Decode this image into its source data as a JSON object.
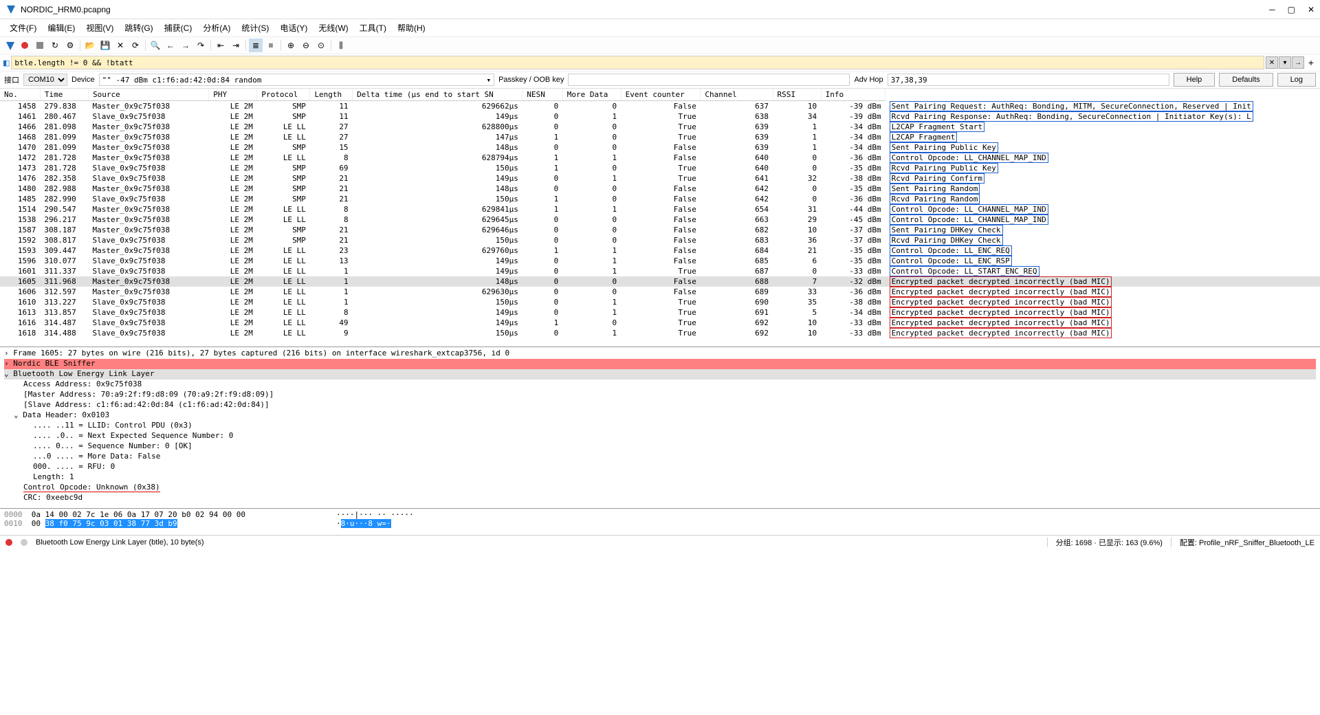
{
  "window": {
    "title": "NORDIC_HRM0.pcapng"
  },
  "menu": [
    "文件(F)",
    "编辑(E)",
    "视图(V)",
    "跳转(G)",
    "捕获(C)",
    "分析(A)",
    "统计(S)",
    "电话(Y)",
    "无线(W)",
    "工具(T)",
    "帮助(H)"
  ],
  "filter": {
    "value": "btle.length != 0 && !btatt"
  },
  "second": {
    "interface_label": "接口",
    "interface_value": "COM10",
    "device_label": "Device",
    "device_value": "\"\"  -47 dBm  c1:f6:ad:42:0d:84  random",
    "passkey_label": "Passkey / OOB key",
    "advhop_label": "Adv Hop",
    "advhop_value": "37,38,39",
    "buttons": {
      "help": "Help",
      "defaults": "Defaults",
      "log": "Log"
    }
  },
  "columns": [
    "No.",
    "Time",
    "Source",
    "PHY",
    "Protocol",
    "Length",
    "Delta time (µs end to start SN",
    "NESN",
    "More Data",
    "Event counter",
    "Channel",
    "RSSI",
    "Info"
  ],
  "rows": [
    {
      "no": 1458,
      "time": "279.838",
      "src": "Master_0x9c75f038",
      "phy": "LE 2M",
      "prot": "SMP",
      "len": 11,
      "delta": "629662µs",
      "sn": 0,
      "nesn": 0,
      "more": "False",
      "evt": 637,
      "ch": 10,
      "rssi": "-39 dBm",
      "info": "Sent Pairing Request: AuthReq: Bonding, MITM, SecureConnection, Reserved | Init",
      "box": "blue"
    },
    {
      "no": 1461,
      "time": "280.467",
      "src": "Slave_0x9c75f038",
      "phy": "LE 2M",
      "prot": "SMP",
      "len": 11,
      "delta": "149µs",
      "sn": 0,
      "nesn": 1,
      "more": "True",
      "evt": 638,
      "ch": 34,
      "rssi": "-39 dBm",
      "info": "Rcvd Pairing Response: AuthReq: Bonding, SecureConnection | Initiator Key(s): L",
      "box": "blue"
    },
    {
      "no": 1466,
      "time": "281.098",
      "src": "Master_0x9c75f038",
      "phy": "LE 2M",
      "prot": "LE LL",
      "len": 27,
      "delta": "628800µs",
      "sn": 0,
      "nesn": 0,
      "more": "True",
      "evt": 639,
      "ch": 1,
      "rssi": "-34 dBm",
      "info": "L2CAP Fragment Start",
      "box": "blue"
    },
    {
      "no": 1468,
      "time": "281.099",
      "src": "Master_0x9c75f038",
      "phy": "LE 2M",
      "prot": "LE LL",
      "len": 27,
      "delta": "147µs",
      "sn": 1,
      "nesn": 0,
      "more": "True",
      "evt": 639,
      "ch": 1,
      "rssi": "-34 dBm",
      "info": "L2CAP Fragment",
      "box": "blue"
    },
    {
      "no": 1470,
      "time": "281.099",
      "src": "Master_0x9c75f038",
      "phy": "LE 2M",
      "prot": "SMP",
      "len": 15,
      "delta": "148µs",
      "sn": 0,
      "nesn": 0,
      "more": "False",
      "evt": 639,
      "ch": 1,
      "rssi": "-34 dBm",
      "info": "Sent Pairing Public Key",
      "box": "blue"
    },
    {
      "no": 1472,
      "time": "281.728",
      "src": "Master_0x9c75f038",
      "phy": "LE 2M",
      "prot": "LE LL",
      "len": 8,
      "delta": "628794µs",
      "sn": 1,
      "nesn": 1,
      "more": "False",
      "evt": 640,
      "ch": 0,
      "rssi": "-36 dBm",
      "info": "Control Opcode: LL_CHANNEL_MAP_IND",
      "box": "blue"
    },
    {
      "no": 1473,
      "time": "281.728",
      "src": "Slave_0x9c75f038",
      "phy": "LE 2M",
      "prot": "SMP",
      "len": 69,
      "delta": "150µs",
      "sn": 1,
      "nesn": 0,
      "more": "True",
      "evt": 640,
      "ch": 0,
      "rssi": "-35 dBm",
      "info": "Rcvd Pairing Public Key",
      "box": "blue"
    },
    {
      "no": 1476,
      "time": "282.358",
      "src": "Slave_0x9c75f038",
      "phy": "LE 2M",
      "prot": "SMP",
      "len": 21,
      "delta": "149µs",
      "sn": 0,
      "nesn": 1,
      "more": "True",
      "evt": 641,
      "ch": 32,
      "rssi": "-38 dBm",
      "info": "Rcvd Pairing Confirm",
      "box": "blue"
    },
    {
      "no": 1480,
      "time": "282.988",
      "src": "Master_0x9c75f038",
      "phy": "LE 2M",
      "prot": "SMP",
      "len": 21,
      "delta": "148µs",
      "sn": 0,
      "nesn": 0,
      "more": "False",
      "evt": 642,
      "ch": 0,
      "rssi": "-35 dBm",
      "info": "Sent Pairing Random",
      "box": "blue"
    },
    {
      "no": 1485,
      "time": "282.990",
      "src": "Slave_0x9c75f038",
      "phy": "LE 2M",
      "prot": "SMP",
      "len": 21,
      "delta": "150µs",
      "sn": 1,
      "nesn": 0,
      "more": "False",
      "evt": 642,
      "ch": 0,
      "rssi": "-36 dBm",
      "info": "Rcvd Pairing Random",
      "box": "blue"
    },
    {
      "no": 1514,
      "time": "290.547",
      "src": "Master_0x9c75f038",
      "phy": "LE 2M",
      "prot": "LE LL",
      "len": 8,
      "delta": "629841µs",
      "sn": 1,
      "nesn": 1,
      "more": "False",
      "evt": 654,
      "ch": 31,
      "rssi": "-44 dBm",
      "info": "Control Opcode: LL_CHANNEL_MAP_IND",
      "box": "blue"
    },
    {
      "no": 1538,
      "time": "296.217",
      "src": "Master_0x9c75f038",
      "phy": "LE 2M",
      "prot": "LE LL",
      "len": 8,
      "delta": "629645µs",
      "sn": 0,
      "nesn": 0,
      "more": "False",
      "evt": 663,
      "ch": 29,
      "rssi": "-45 dBm",
      "info": "Control Opcode: LL_CHANNEL_MAP_IND",
      "box": "blue"
    },
    {
      "no": 1587,
      "time": "308.187",
      "src": "Master_0x9c75f038",
      "phy": "LE 2M",
      "prot": "SMP",
      "len": 21,
      "delta": "629646µs",
      "sn": 0,
      "nesn": 0,
      "more": "False",
      "evt": 682,
      "ch": 10,
      "rssi": "-37 dBm",
      "info": "Sent Pairing DHKey Check",
      "box": "blue"
    },
    {
      "no": 1592,
      "time": "308.817",
      "src": "Slave_0x9c75f038",
      "phy": "LE 2M",
      "prot": "SMP",
      "len": 21,
      "delta": "150µs",
      "sn": 0,
      "nesn": 0,
      "more": "False",
      "evt": 683,
      "ch": 36,
      "rssi": "-37 dBm",
      "info": "Rcvd Pairing DHKey Check",
      "box": "blue"
    },
    {
      "no": 1593,
      "time": "309.447",
      "src": "Master_0x9c75f038",
      "phy": "LE 2M",
      "prot": "LE LL",
      "len": 23,
      "delta": "629760µs",
      "sn": 1,
      "nesn": 1,
      "more": "False",
      "evt": 684,
      "ch": 21,
      "rssi": "-35 dBm",
      "info": "Control Opcode: LL_ENC_REQ",
      "box": "blue"
    },
    {
      "no": 1596,
      "time": "310.077",
      "src": "Slave_0x9c75f038",
      "phy": "LE 2M",
      "prot": "LE LL",
      "len": 13,
      "delta": "149µs",
      "sn": 0,
      "nesn": 1,
      "more": "False",
      "evt": 685,
      "ch": 6,
      "rssi": "-35 dBm",
      "info": "Control Opcode: LL_ENC_RSP",
      "box": "blue"
    },
    {
      "no": 1601,
      "time": "311.337",
      "src": "Slave_0x9c75f038",
      "phy": "LE 2M",
      "prot": "LE LL",
      "len": 1,
      "delta": "149µs",
      "sn": 0,
      "nesn": 1,
      "more": "True",
      "evt": 687,
      "ch": 0,
      "rssi": "-33 dBm",
      "info": "Control Opcode: LL_START_ENC_REQ",
      "box": "blue"
    },
    {
      "no": 1605,
      "time": "311.968",
      "src": "Master_0x9c75f038",
      "phy": "LE 2M",
      "prot": "LE LL",
      "len": 1,
      "delta": "148µs",
      "sn": 0,
      "nesn": 0,
      "more": "False",
      "evt": 688,
      "ch": 7,
      "rssi": "-32 dBm",
      "info": "Encrypted packet decrypted incorrectly (bad MIC)",
      "box": "red",
      "sel": true
    },
    {
      "no": 1606,
      "time": "312.597",
      "src": "Master_0x9c75f038",
      "phy": "LE 2M",
      "prot": "LE LL",
      "len": 1,
      "delta": "629630µs",
      "sn": 0,
      "nesn": 0,
      "more": "False",
      "evt": 689,
      "ch": 33,
      "rssi": "-36 dBm",
      "info": "Encrypted packet decrypted incorrectly (bad MIC)",
      "box": "red"
    },
    {
      "no": 1610,
      "time": "313.227",
      "src": "Slave_0x9c75f038",
      "phy": "LE 2M",
      "prot": "LE LL",
      "len": 1,
      "delta": "150µs",
      "sn": 0,
      "nesn": 1,
      "more": "True",
      "evt": 690,
      "ch": 35,
      "rssi": "-38 dBm",
      "info": "Encrypted packet decrypted incorrectly (bad MIC)",
      "box": "red"
    },
    {
      "no": 1613,
      "time": "313.857",
      "src": "Slave_0x9c75f038",
      "phy": "LE 2M",
      "prot": "LE LL",
      "len": 8,
      "delta": "149µs",
      "sn": 0,
      "nesn": 1,
      "more": "True",
      "evt": 691,
      "ch": 5,
      "rssi": "-34 dBm",
      "info": "Encrypted packet decrypted incorrectly (bad MIC)",
      "box": "red"
    },
    {
      "no": 1616,
      "time": "314.487",
      "src": "Slave_0x9c75f038",
      "phy": "LE 2M",
      "prot": "LE LL",
      "len": 49,
      "delta": "149µs",
      "sn": 1,
      "nesn": 0,
      "more": "True",
      "evt": 692,
      "ch": 10,
      "rssi": "-33 dBm",
      "info": "Encrypted packet decrypted incorrectly (bad MIC)",
      "box": "red"
    },
    {
      "no": 1618,
      "time": "314.488",
      "src": "Slave_0x9c75f038",
      "phy": "LE 2M",
      "prot": "LE LL",
      "len": 9,
      "delta": "150µs",
      "sn": 0,
      "nesn": 1,
      "more": "True",
      "evt": 692,
      "ch": 10,
      "rssi": "-33 dBm",
      "info": "Encrypted packet decrypted incorrectly (bad MIC)",
      "box": "red"
    }
  ],
  "detail": {
    "frame": "Frame 1605: 27 bytes on wire (216 bits), 27 bytes captured (216 bits) on interface wireshark_extcap3756, id 0",
    "nordic": "Nordic BLE Sniffer",
    "ble": "Bluetooth Low Energy Link Layer",
    "access": "Access Address: 0x9c75f038",
    "master": "[Master Address: 70:a9:2f:f9:d8:09 (70:a9:2f:f9:d8:09)]",
    "slave": "[Slave Address: c1:f6:ad:42:0d:84 (c1:f6:ad:42:0d:84)]",
    "datahdr": "Data Header: 0x0103",
    "llid": ".... ..11 = LLID: Control PDU (0x3)",
    "nesn": ".... .0.. = Next Expected Sequence Number: 0",
    "sn": ".... 0... = Sequence Number: 0 [OK]",
    "more": "...0 .... = More Data: False",
    "rfu": "000. .... = RFU: 0",
    "length": "Length: 1",
    "ctrl": "Control Opcode: Unknown (0x38)",
    "crc": "CRC: 0xeebc9d"
  },
  "hex": {
    "off0": "0000",
    "l0": "0a 14 00 02 7c 1e 06 0a  17 07 20 b0 02 94 00 00",
    "a0": "····|··· ·· ·····",
    "off1": "0010",
    "l1_pre": "00 ",
    "l1_sel": "38 f0 75 9c 03 01 38  77 3d b9",
    "a1_pre": "·",
    "a1_sel": "8·u···8 w=·"
  },
  "status": {
    "left": "Bluetooth Low Energy Link Layer (btle), 10 byte(s)",
    "mid": "分组: 1698 · 已显示: 163 (9.6%)",
    "right": "配置: Profile_nRF_Sniffer_Bluetooth_LE"
  }
}
